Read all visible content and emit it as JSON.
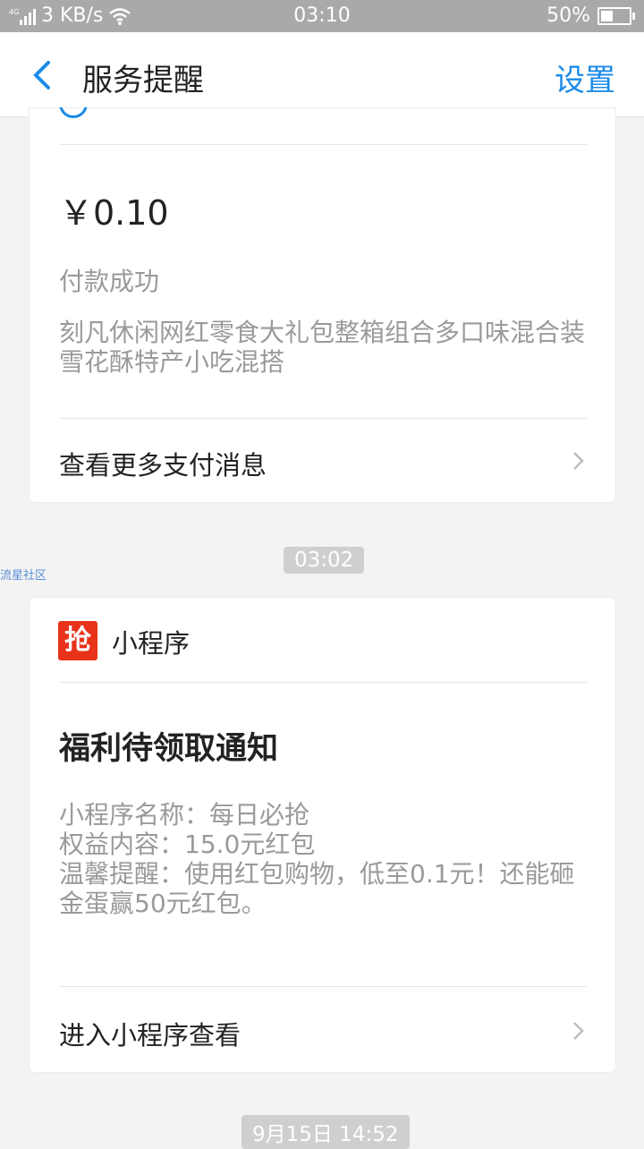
{
  "status_bar": {
    "network": "4G",
    "speed": "3 KB/s",
    "time": "03:10",
    "battery": "50%",
    "battery_level": 0.5
  },
  "nav": {
    "title": "服务提醒",
    "settings_label": "设置"
  },
  "payment_card": {
    "amount": "￥0.10",
    "status": "付款成功",
    "description": "刻凡休闲网红零食大礼包整箱组合多口味混合装雪花酥特产小吃混搭",
    "more_link": "查看更多支付消息"
  },
  "timestamps": {
    "t1": "03:02",
    "t2": "9月15日 14:52"
  },
  "watermark": "流星社区",
  "mini_program_card": {
    "icon_char": "抢",
    "source": "小程序",
    "title": "福利待领取通知",
    "lines": [
      "小程序名称：每日必抢",
      "权益内容：15.0元红包",
      "温馨提醒：使用红包购物，低至0.1元！还能砸金蛋赢50元红包。"
    ],
    "link": "进入小程序查看"
  },
  "colors": {
    "accent": "#1a8be8",
    "background": "#f3f3f3",
    "icon_red": "#e8331a"
  }
}
